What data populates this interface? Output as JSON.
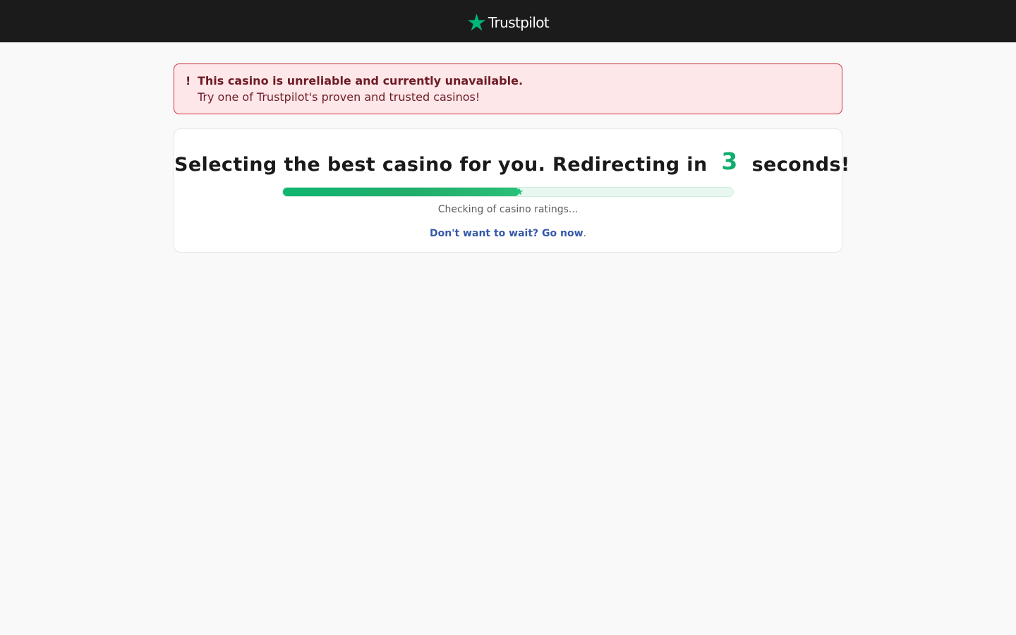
{
  "header": {
    "brand": "Trustpilot",
    "logo_icon": "star-icon",
    "background": "#1b1b1b",
    "star_color": "#00b67a"
  },
  "alert": {
    "mark": "!",
    "title": "This casino is unreliable and currently unavailable.",
    "message": "Try one of Trustpilot's proven and trusted casinos!",
    "background": "#fee7e8",
    "border_color": "#c8303c",
    "text_color": "#6d1b26"
  },
  "redirect": {
    "headline_before": "Selecting the best casino for you. Redirecting in",
    "countdown": "3",
    "headline_after": "seconds!",
    "progress_percent": 52.5,
    "status": "Checking of casino ratings...",
    "go_now_label": "Don't want to wait? Go now",
    "go_now_suffix": ".",
    "accent": "#0fae6c",
    "link_color": "#3559a8"
  }
}
